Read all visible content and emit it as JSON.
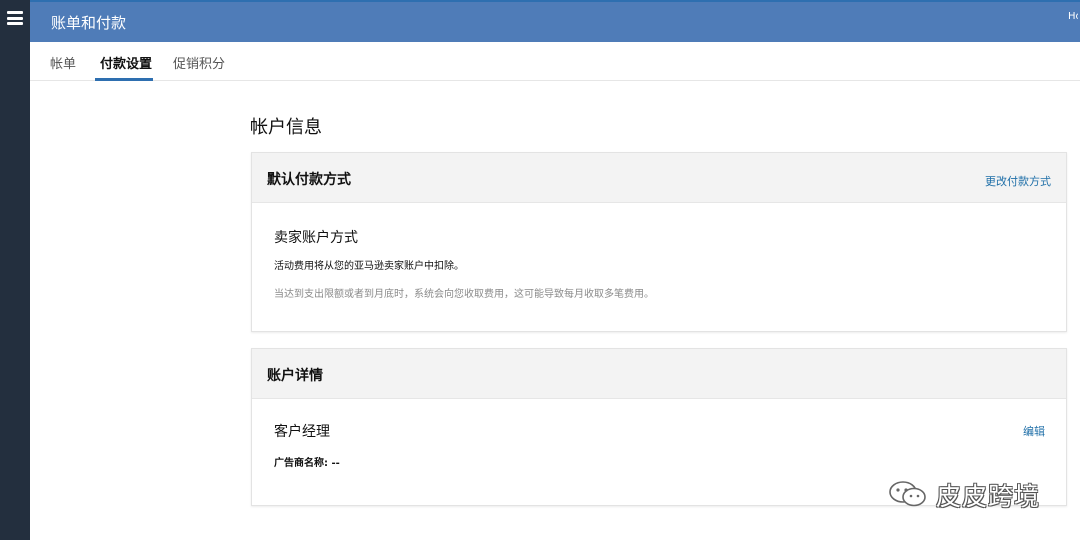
{
  "app": {
    "title": "账单和付款",
    "header_right_partial": "Ho"
  },
  "tabs": [
    {
      "label": "帐单"
    },
    {
      "label": "付款设置"
    },
    {
      "label": "促销积分"
    }
  ],
  "active_tab": "付款设置",
  "main": {
    "section_title": "帐户信息",
    "payment_card": {
      "header": "默认付款方式",
      "link": "更改付款方式",
      "method_title": "卖家账户方式",
      "description": "活动费用将从您的亚马逊卖家账户中扣除。",
      "note": "当达到支出限额或者到月底时，系统会向您收取费用，这可能导致每月收取多笔费用。"
    },
    "details_card": {
      "header": "账户详情",
      "manager_title": "客户经理",
      "edit_link": "编辑",
      "advertiser_label": "广告商名称: --"
    }
  },
  "watermark": {
    "text": "皮皮跨境",
    "icon": "wechat-icon"
  },
  "colors": {
    "header_bg": "#4f7cb8",
    "left_rail": "#232f3e",
    "accent": "#2e6fb0",
    "link": "#1f6fa8",
    "card_header_bg": "#f3f3f3"
  }
}
